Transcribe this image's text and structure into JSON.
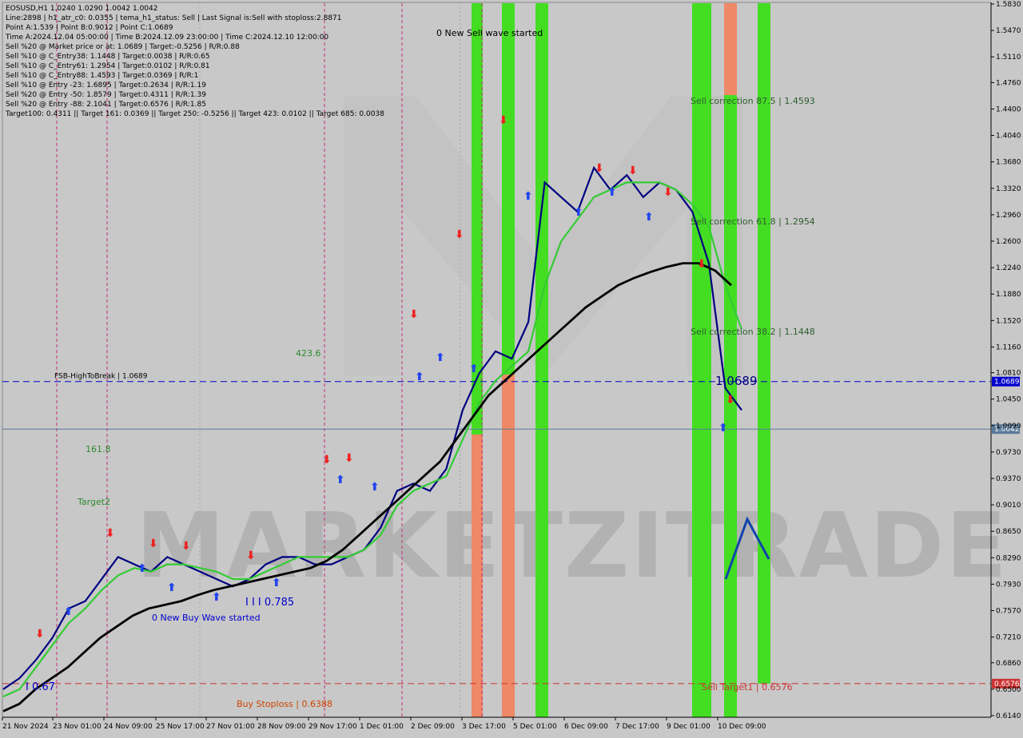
{
  "info_lines": [
    "EOSUSD,H1  1.0240 1.0290 1.0042 1.0042",
    "Line:2898 | h1_atr_c0: 0.0355 | tema_h1_status: Sell | Last Signal is:Sell with stoploss:2.8871",
    "Point A:1.539 | Point B:0.9012 | Point C:1.0689",
    "Time A:2024.12.04 05:00:00 | Time B:2024.12.09 23:00:00 | Time C:2024.12.10 12:00:00",
    "Sell %20 @ Market price or at: 1.0689 | Target:-0.5256 | R/R:0.88",
    "Sell %10 @ C_Entry38: 1.1448 | Target:0.0038 | R/R:0.65",
    "Sell %10 @ C_Entry61: 1.2954 | Target:0.0102 | R/R:0.81",
    "Sell %10 @ C_Entry88: 1.4593 | Target:0.0369 | R/R:1",
    "Sell %10 @ Entry -23: 1.6895 | Target:0.2634 | R/R:1.19",
    "Sell %20 @ Entry -50: 1.8579 | Target:0.4311 | R/R:1.39",
    "Sell %20 @ Entry -88: 2.1041 | Target:0.6576 | R/R:1.85",
    "Target100: 0.4311 || Target 161: 0.0369 || Target 250: -0.5256 || Target 423: 0.0102 || Target 685: 0.0038"
  ],
  "chart_data": {
    "type": "line",
    "symbol": "EOSUSD",
    "timeframe": "H1",
    "ylim": [
      0.614,
      1.583
    ],
    "y_ticks": [
      1.583,
      1.547,
      1.511,
      1.476,
      1.44,
      1.404,
      1.368,
      1.332,
      1.296,
      1.26,
      1.224,
      1.188,
      1.152,
      1.116,
      1.081,
      1.045,
      1.009,
      0.973,
      0.937,
      0.901,
      0.865,
      0.829,
      0.793,
      0.757,
      0.721,
      0.686,
      0.65,
      0.614
    ],
    "x_ticks": [
      "21 Nov 2024",
      "23 Nov 01:00",
      "24 Nov 09:00",
      "25 Nov 17:00",
      "27 Nov 01:00",
      "28 Nov 09:00",
      "29 Nov 17:00",
      "1 Dec 01:00",
      "2 Dec 09:00",
      "3 Dec 17:00",
      "5 Dec 01:00",
      "6 Dec 09:00",
      "7 Dec 17:00",
      "9 Dec 01:00",
      "10 Dec 09:00"
    ],
    "x_count": 14,
    "series": [
      {
        "values": [
          0.65,
          0.665,
          0.69,
          0.72,
          0.76,
          0.77,
          0.8,
          0.83,
          0.82,
          0.81,
          0.83,
          0.82,
          0.81,
          0.8,
          0.79,
          0.8,
          0.82,
          0.83,
          0.83,
          0.82,
          0.82,
          0.83,
          0.84,
          0.87,
          0.92,
          0.93,
          0.92,
          0.95,
          1.03,
          1.08,
          1.11,
          1.1,
          1.15,
          1.34,
          1.32,
          1.3,
          1.36,
          1.33,
          1.35,
          1.32,
          1.34,
          1.33,
          1.3,
          1.23,
          1.06,
          1.03
        ],
        "color": "#000080"
      },
      {
        "values": [
          0.64,
          0.65,
          0.68,
          0.71,
          0.74,
          0.76,
          0.785,
          0.805,
          0.815,
          0.81,
          0.82,
          0.82,
          0.815,
          0.81,
          0.8,
          0.8,
          0.81,
          0.82,
          0.83,
          0.83,
          0.83,
          0.83,
          0.84,
          0.86,
          0.9,
          0.92,
          0.93,
          0.94,
          0.99,
          1.04,
          1.07,
          1.09,
          1.11,
          1.2,
          1.26,
          1.29,
          1.32,
          1.33,
          1.34,
          1.34,
          1.34,
          1.33,
          1.31,
          1.28,
          1.2,
          1.14
        ],
        "color": "#33cc33"
      },
      {
        "values": [
          0.62,
          0.63,
          0.65,
          0.665,
          0.68,
          0.7,
          0.72,
          0.735,
          0.75,
          0.76,
          0.765,
          0.77,
          0.778,
          0.785,
          0.79,
          0.795,
          0.8,
          0.805,
          0.81,
          0.815,
          0.825,
          0.84,
          0.86,
          0.88,
          0.9,
          0.92,
          0.94,
          0.96,
          0.99,
          1.02,
          1.05,
          1.07,
          1.09,
          1.11,
          1.13,
          1.15,
          1.17,
          1.185,
          1.2,
          1.21,
          1.218,
          1.225,
          1.23,
          1.23,
          1.22,
          1.2
        ],
        "color": "#000000"
      }
    ],
    "levels": [
      {
        "label": "FSB-HighToBreak | 1.0689",
        "value": 1.0689,
        "color": "#0000cc",
        "tag": "1.0689"
      },
      {
        "label": "",
        "value": 1.0042,
        "color": "#5b7a99",
        "tag": "1.0042"
      },
      {
        "label": "Sell Target1 | 0.6576",
        "value": 0.6576,
        "color": "#cc3333",
        "tag": "0.6576"
      }
    ],
    "annotations": [
      {
        "text": "0 New Sell wave started",
        "color": "#000000"
      },
      {
        "text": "0 New Buy Wave started",
        "color": "#0000cc"
      },
      {
        "text": "Sell correction 87.5 | 1.4593",
        "color": "#2e5d2e"
      },
      {
        "text": "Sell correction 61.8 | 1.2954",
        "color": "#2e5d2e"
      },
      {
        "text": "Sell correction 38.2 | 1.1448",
        "color": "#2e5d2e"
      },
      {
        "text": "Buy Stoploss | 0.6388",
        "color": "#cc4400"
      },
      {
        "text": "423.6",
        "color": "#2e8b2e"
      },
      {
        "text": "161.8",
        "color": "#2e8b2e"
      },
      {
        "text": "Target2",
        "color": "#2e8b2e"
      },
      {
        "text": "1.0689",
        "color": "#000080"
      },
      {
        "text": "I I I 0.785",
        "color": "#0000cc"
      },
      {
        "text": "I 0.67",
        "color": "#0000cc"
      }
    ],
    "grid": false
  },
  "watermark": "MARKETZITRADE"
}
